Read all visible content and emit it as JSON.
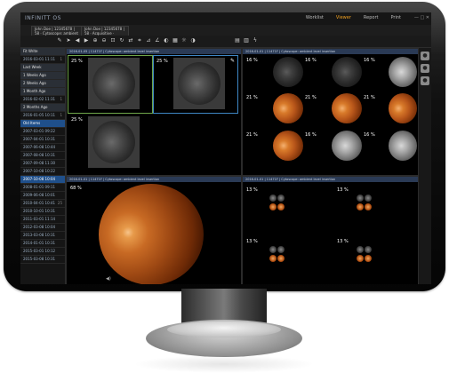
{
  "app": {
    "logo": "INFINITT OS",
    "nav": [
      "Worklist",
      "Viewer",
      "Report",
      "Print"
    ],
    "active_nav": "Viewer",
    "window_controls": "— □ ✕"
  },
  "patient_tabs": [
    {
      "label": "John Doe | 12345678 | 58 · Cytoscope: ambient level insertion"
    },
    {
      "label": "John Doe | 12345678 | 58 · Acquisitive · 2011-11-28"
    }
  ],
  "toolbar_icons": [
    "pen-icon",
    "pointer-icon",
    "prev-icon",
    "next-icon",
    "zoom-in-icon",
    "zoom-out-icon",
    "fit-icon",
    "rotate-icon",
    "flip-icon",
    "crop-icon",
    "measure-icon",
    "angle-icon",
    "invert-icon",
    "grid-icon",
    "layout-icon",
    "sync-icon"
  ],
  "sidebar": {
    "groups": [
      {
        "label": "Fit Write",
        "kind": "head"
      },
      {
        "label": "2016-03-01 11:11",
        "kind": "date",
        "count": "1"
      },
      {
        "label": "Last Week",
        "kind": "head"
      },
      {
        "label": "1 Weeks Ago",
        "kind": "head"
      },
      {
        "label": "2 Weeks Ago",
        "kind": "head"
      },
      {
        "label": "1 Month Ago",
        "kind": "head"
      },
      {
        "label": "2016-02-02 11:31",
        "kind": "date",
        "count": "1"
      },
      {
        "label": "2 Months Ago",
        "kind": "head"
      },
      {
        "label": "2016-01-05 10:11",
        "kind": "date",
        "count": "1"
      },
      {
        "label": "Old Items",
        "kind": "sel"
      },
      {
        "label": "2007-03-01 09:22",
        "kind": "date",
        "count": ""
      },
      {
        "label": "2007-04-01 10:31",
        "kind": "date",
        "count": ""
      },
      {
        "label": "2007-06-08 10:44",
        "kind": "date",
        "count": ""
      },
      {
        "label": "2007-08-08 10:31",
        "kind": "date",
        "count": ""
      },
      {
        "label": "2007-09-08 11:30",
        "kind": "date",
        "count": ""
      },
      {
        "label": "2007-10-08 10:22",
        "kind": "date",
        "count": ""
      },
      {
        "label": "2007-10-08 10:04",
        "kind": "sel",
        "count": ""
      },
      {
        "label": "2008-01-01 09:11",
        "kind": "date",
        "count": ""
      },
      {
        "label": "2009-06-08 10:01",
        "kind": "date",
        "count": ""
      },
      {
        "label": "2010-04-01 10:41",
        "kind": "date",
        "count": "25"
      },
      {
        "label": "2010-10-01 10:31",
        "kind": "date",
        "count": ""
      },
      {
        "label": "2011-03-01 11:14",
        "kind": "date",
        "count": ""
      },
      {
        "label": "2012-03-08 10:04",
        "kind": "date",
        "count": ""
      },
      {
        "label": "2013-03-08 10:31",
        "kind": "date",
        "count": ""
      },
      {
        "label": "2014-01-01 10:31",
        "kind": "date",
        "count": ""
      },
      {
        "label": "2015-03-01 10:12",
        "kind": "date",
        "count": ""
      },
      {
        "label": "2015-03-08 10:31",
        "kind": "date",
        "count": ""
      }
    ]
  },
  "panels": {
    "top_left": {
      "header": "2016-01-05 | 11471F | Cytoscope: ambient level insertion",
      "zoom": [
        "25 %",
        "25 %",
        "25 %"
      ]
    },
    "top_right": {
      "header": "2016-01-01 | 11471F | Cytoscope: ambient level insertion",
      "zoom": [
        "16 %",
        "16 %",
        "16 %",
        "21 %",
        "21 %",
        "21 %",
        "21 %",
        "16 %",
        "16 %"
      ]
    },
    "bottom_left": {
      "header": "2016-01-01 | 11471F | Cytoscope: ambient level insertion",
      "zoom": "68 %"
    },
    "bottom_right": {
      "header": "2016-01-01 | 11471F | Cytoscope: ambient level insertion",
      "zoom": [
        "13 %",
        "13 %",
        "13 %",
        "13 %"
      ]
    }
  }
}
